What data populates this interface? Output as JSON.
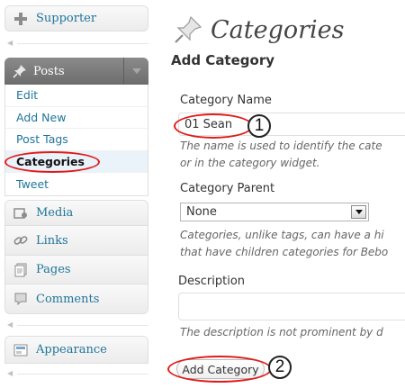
{
  "sidebar": {
    "supporter": {
      "label": "Supporter",
      "icon": "plus-icon"
    },
    "posts": {
      "label": "Posts",
      "icon": "pushpin-icon",
      "submenu": [
        {
          "label": "Edit"
        },
        {
          "label": "Add New"
        },
        {
          "label": "Post Tags"
        },
        {
          "label": "Categories",
          "current": true
        },
        {
          "label": "Tweet"
        }
      ]
    },
    "media": {
      "label": "Media",
      "icon": "media-icon"
    },
    "links": {
      "label": "Links",
      "icon": "chain-link-icon"
    },
    "pages": {
      "label": "Pages",
      "icon": "pages-icon"
    },
    "comments": {
      "label": "Comments",
      "icon": "speech-bubble-icon"
    },
    "appearance": {
      "label": "Appearance",
      "icon": "appearance-icon"
    }
  },
  "main": {
    "title": "Categories",
    "title_icon": "pushpin-icon",
    "add_heading": "Add Category",
    "name": {
      "label": "Category Name",
      "value": "01 Sean",
      "help": [
        "The name is used to identify the cate",
        "or in the category widget."
      ]
    },
    "parent": {
      "label": "Category Parent",
      "selected": "None",
      "help": [
        "Categories, unlike tags, can have a hi",
        "that have children categories for Bebo"
      ]
    },
    "description": {
      "label": "Description",
      "value": "",
      "help": "The description is not prominent by d"
    },
    "submit_label": "Add Category"
  },
  "annotations": {
    "color": "#e01b1b",
    "step1": "1",
    "step2": "2"
  },
  "colors": {
    "link": "#21759b",
    "posts_header": "#7a7a7a",
    "current_bg": "#eaf2fa"
  }
}
